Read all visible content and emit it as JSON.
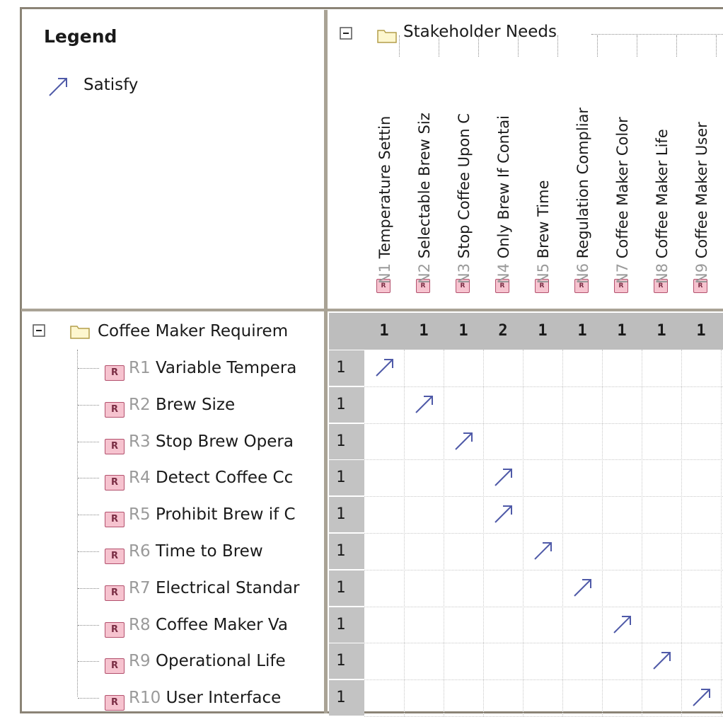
{
  "legend": {
    "title": "Legend",
    "items": [
      {
        "label": "Satisfy",
        "icon": "satisfy-arrow-icon",
        "color": "#4f5aa8"
      }
    ]
  },
  "columns": {
    "group_label": "Stakeholder Needs",
    "items": [
      {
        "id": "N1",
        "name": "Temperature Settin"
      },
      {
        "id": "N2",
        "name": "Selectable Brew Siz"
      },
      {
        "id": "N3",
        "name": "Stop Coffee Upon C"
      },
      {
        "id": "N4",
        "name": "Only Brew If Contai"
      },
      {
        "id": "N5",
        "name": "Brew Time"
      },
      {
        "id": "N6",
        "name": "Regulation Compliar"
      },
      {
        "id": "N7",
        "name": "Coffee Maker Color"
      },
      {
        "id": "N8",
        "name": "Coffee Maker Life"
      },
      {
        "id": "N9",
        "name": "Coffee Maker User"
      }
    ],
    "totals": [
      "1",
      "1",
      "1",
      "2",
      "1",
      "1",
      "1",
      "1",
      "1"
    ]
  },
  "rows": {
    "group_label": "Coffee Maker Requirem",
    "items": [
      {
        "id": "R1",
        "name": "Variable Tempera",
        "total": "1",
        "satisfies_col": 0
      },
      {
        "id": "R2",
        "name": "Brew Size",
        "total": "1",
        "satisfies_col": 1
      },
      {
        "id": "R3",
        "name": "Stop Brew Opera",
        "total": "1",
        "satisfies_col": 2
      },
      {
        "id": "R4",
        "name": "Detect Coffee Cc",
        "total": "1",
        "satisfies_col": 3
      },
      {
        "id": "R5",
        "name": "Prohibit Brew if C",
        "total": "1",
        "satisfies_col": 3
      },
      {
        "id": "R6",
        "name": "Time to Brew",
        "total": "1",
        "satisfies_col": 4
      },
      {
        "id": "R7",
        "name": "Electrical Standar",
        "total": "1",
        "satisfies_col": 5
      },
      {
        "id": "R8",
        "name": "Coffee Maker Va",
        "total": "1",
        "satisfies_col": 6
      },
      {
        "id": "R9",
        "name": "Operational Life",
        "total": "1",
        "satisfies_col": 7
      },
      {
        "id": "R10",
        "name": "User Interface",
        "total": "1",
        "satisfies_col": 8
      }
    ]
  },
  "badge_letter": "R",
  "colors": {
    "arrow": "#4f5aa8",
    "badge_fill": "#f6c3cf",
    "badge_border": "#b3506d",
    "summary_fill": "#c3c3c3",
    "frame": "#8b8476"
  }
}
